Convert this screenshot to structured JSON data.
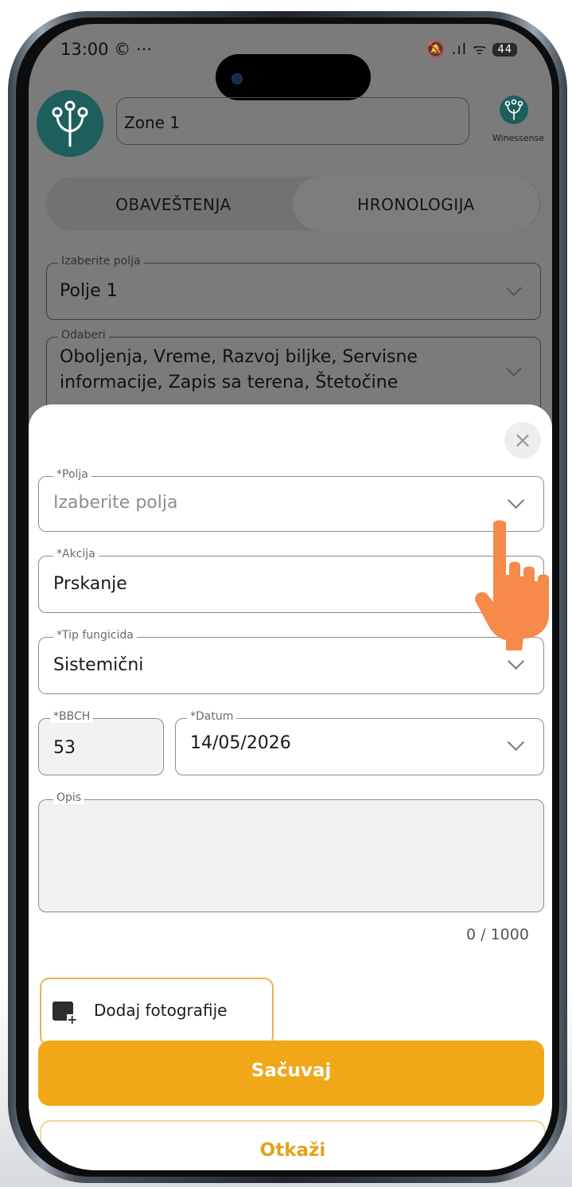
{
  "status_bar": {
    "time": "13:00",
    "extra": "© ···",
    "icons": "🔕 .ıl ᯤ",
    "battery": "44"
  },
  "header": {
    "zone_value": "Zone 1",
    "brand_name": "Winessense"
  },
  "tabs": [
    {
      "label": "OBAVEŠTENJA"
    },
    {
      "label": "HRONOLOGIJA"
    }
  ],
  "filters": {
    "field_legend": "Izaberite polja",
    "field_value": "Polje 1",
    "select_legend": "Odaberi",
    "select_value_line1": "Oboljenja, Vreme, Razvoj biljke, Servisne",
    "select_value_line2": "informacije, Zapis sa terena, Štetočine"
  },
  "form": {
    "close_glyph": "×",
    "polja": {
      "legend": "*Polja",
      "placeholder": "Izaberite polja"
    },
    "akcija": {
      "legend": "*Akcija",
      "value": "Prskanje"
    },
    "tip": {
      "legend": "*Tip fungicida",
      "value": "Sistemični"
    },
    "bbch": {
      "legend": "*BBCH",
      "value": "53"
    },
    "datum": {
      "legend": "*Datum",
      "value": "14/05/2026"
    },
    "opis": {
      "legend": "Opis",
      "value": ""
    },
    "counter": "0 / 1000",
    "add_photo_label": "Dodaj fotografije",
    "save_label": "Sačuvaj",
    "cancel_label": "Otkaži"
  },
  "colors": {
    "accent": "#f0a818",
    "brand": "#1e5f5e",
    "overlay": "#7b7b7b",
    "hand": "#f58a4b"
  }
}
